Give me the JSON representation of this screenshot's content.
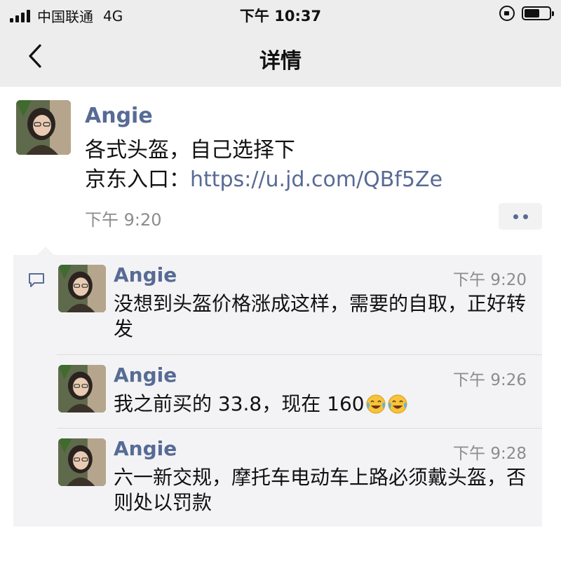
{
  "status_bar": {
    "carrier": "中国联通",
    "network": "4G",
    "time": "下午 10:37"
  },
  "nav": {
    "title": "详情"
  },
  "post": {
    "author": "Angie",
    "line1": "各式头盔，自己选择下",
    "line2_prefix": "京东入口：",
    "link": "https://u.jd.com/QBf5Ze",
    "time": "下午 9:20"
  },
  "comments": [
    {
      "author": "Angie",
      "time": "下午 9:20",
      "text": "没想到头盔价格涨成这样，需要的自取，正好转发"
    },
    {
      "author": "Angie",
      "time": "下午 9:26",
      "text": "我之前买的 33.8，现在 160",
      "emoji": "face-with-tears-of-joy"
    },
    {
      "author": "Angie",
      "time": "下午 9:28",
      "text": "六一新交规，摩托车电动车上路必须戴头盔，否则处以罚款"
    }
  ],
  "colors": {
    "name_link": "#576b95",
    "timestamp": "#8c8c8c",
    "comment_bg": "#f3f3f5",
    "header_bg": "#ededed"
  }
}
